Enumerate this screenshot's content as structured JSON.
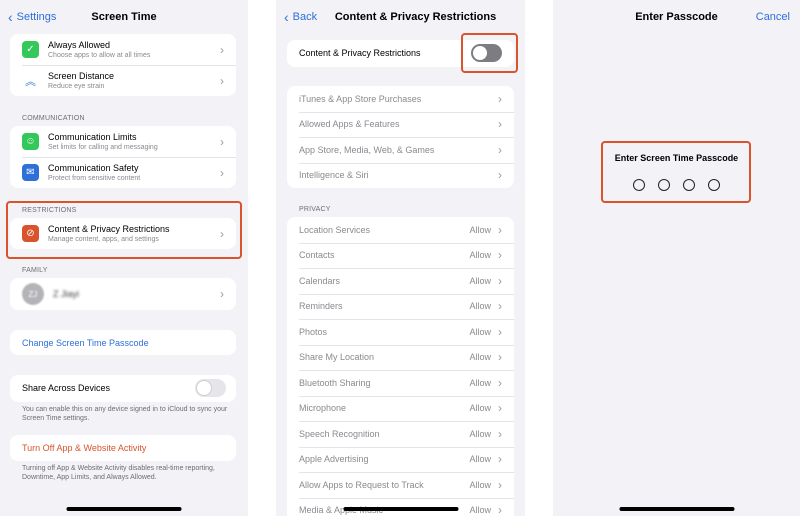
{
  "panel1": {
    "nav": {
      "back_label": "Settings",
      "title": "Screen Time"
    },
    "top_items": [
      {
        "title": "Always Allowed",
        "subtitle": "Choose apps to allow at all times",
        "icon": "checkmark-icon",
        "color": "#34c759"
      },
      {
        "title": "Screen Distance",
        "subtitle": "Reduce eye strain",
        "icon": "chevrons-icon",
        "color": "#2f6fd8"
      }
    ],
    "communication": {
      "label": "COMMUNICATION",
      "items": [
        {
          "title": "Communication Limits",
          "subtitle": "Set limits for calling and messaging",
          "icon": "person-circle-icon",
          "color": "#34c759"
        },
        {
          "title": "Communication Safety",
          "subtitle": "Protect from sensitive content",
          "icon": "chat-bubble-icon",
          "color": "#2f6fd8"
        }
      ]
    },
    "restrictions": {
      "label": "RESTRICTIONS",
      "item": {
        "title": "Content & Privacy Restrictions",
        "subtitle": "Manage content, apps, and settings",
        "icon": "no-entry-icon",
        "color": "#d9542c"
      }
    },
    "family": {
      "label": "FAMILY",
      "member": {
        "initials": "ZJ",
        "name": "Z Jiayi"
      }
    },
    "change_passcode": "Change Screen Time Passcode",
    "share": {
      "label": "Share Across Devices",
      "footnote": "You can enable this on any device signed in to iCloud to sync your Screen Time settings."
    },
    "turn_off": {
      "label": "Turn Off App & Website Activity",
      "footnote": "Turning off App & Website Activity disables real-time reporting, Downtime, App Limits, and Always Allowed."
    }
  },
  "panel2": {
    "nav": {
      "back_label": "Back",
      "title": "Content & Privacy Restrictions"
    },
    "toggle_label": "Content & Privacy Restrictions",
    "store_items": [
      "iTunes & App Store Purchases",
      "Allowed Apps & Features",
      "App Store, Media, Web, & Games",
      "Intelligence & Siri"
    ],
    "privacy": {
      "label": "PRIVACY",
      "allow_label": "Allow",
      "items": [
        "Location Services",
        "Contacts",
        "Calendars",
        "Reminders",
        "Photos",
        "Share My Location",
        "Bluetooth Sharing",
        "Microphone",
        "Speech Recognition",
        "Apple Advertising",
        "Allow Apps to Request to Track",
        "Media & Apple Music"
      ]
    }
  },
  "panel3": {
    "nav": {
      "title": "Enter Passcode",
      "cancel_label": "Cancel"
    },
    "prompt": "Enter Screen Time Passcode"
  },
  "colors": {
    "accent": "#2f6fd8",
    "highlight": "#d9542c",
    "background": "#f2f2f7"
  }
}
